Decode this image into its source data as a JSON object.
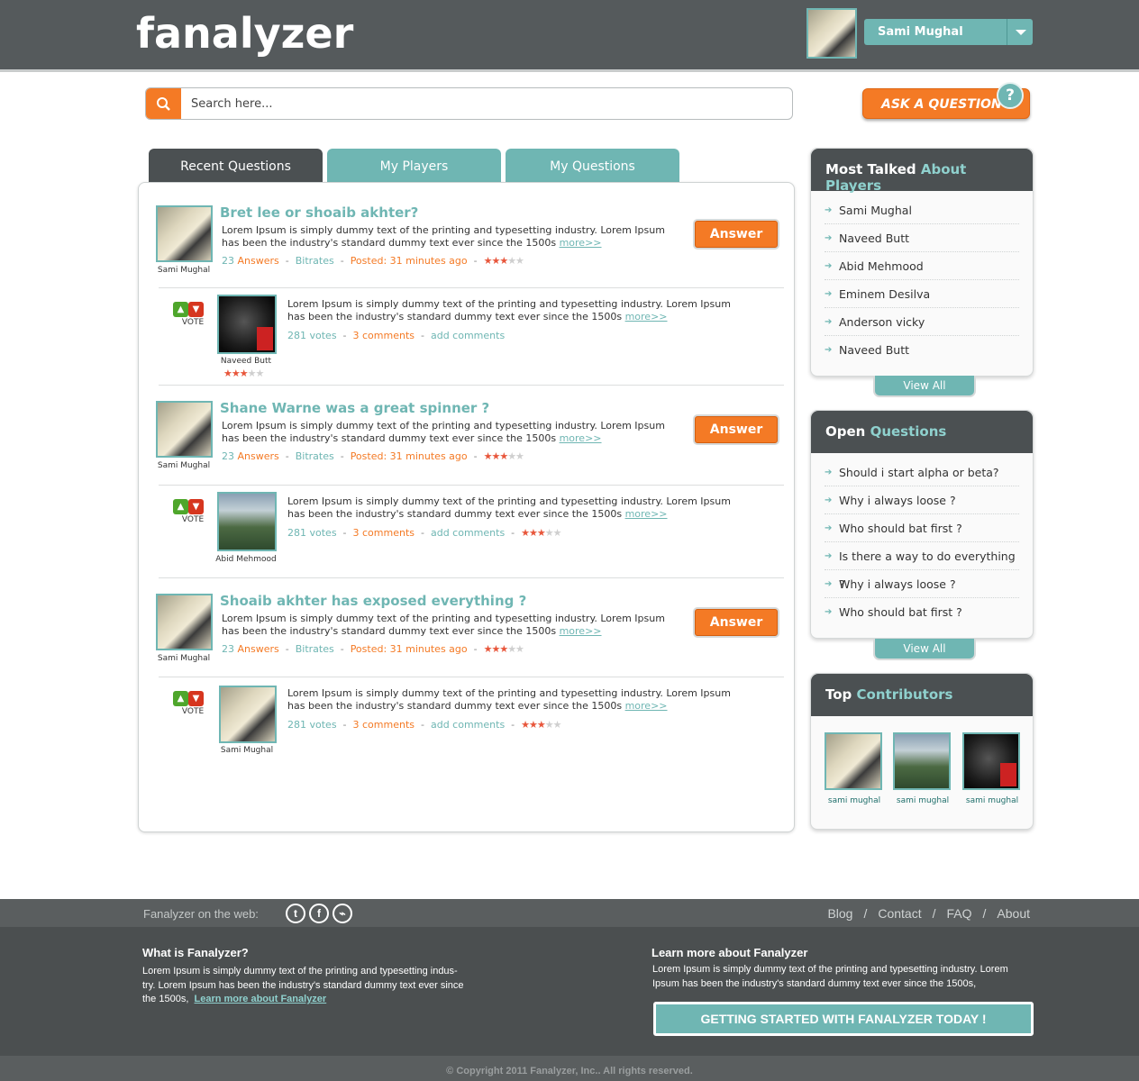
{
  "header": {
    "logo": "fanalyzer",
    "user_name": "Sami Mughal"
  },
  "search": {
    "placeholder": "Search here..."
  },
  "ask_button": "ASK A QUESTION",
  "tabs": [
    {
      "label": "Recent Questions",
      "active": true
    },
    {
      "label": "My Players",
      "active": false
    },
    {
      "label": "My Questions",
      "active": false
    }
  ],
  "questions": [
    {
      "user": "Sami Mughal",
      "title": "Bret lee or shoaib akhter?",
      "text": "Lorem Ipsum is simply dummy text of the printing and typesetting industry. Lorem Ipsum has been the industry's standard dummy text ever since the 1500s",
      "more": "more>>",
      "answers_count": "23",
      "answers_label": "Answers",
      "bitrates": "Bitrates",
      "posted": "Posted: 31 minutes ago",
      "rating": 3,
      "answer_button": "Answer",
      "reply": {
        "user": "Naveed Butt",
        "vote_label": "VOTE",
        "text": "Lorem Ipsum is simply dummy text of the printing and typesetting industry. Lorem Ipsum has been the industry's standard dummy text ever since the 1500s",
        "more": "more>>",
        "votes": "281 votes",
        "comments": "3 comments",
        "add_comments": "add comments",
        "rating": 3
      }
    },
    {
      "user": "Sami Mughal",
      "title": "Shane Warne was a great spinner ?",
      "text": "Lorem Ipsum is simply dummy text of the printing and typesetting industry. Lorem Ipsum has been the industry's standard dummy text ever since the 1500s",
      "more": "more>>",
      "answers_count": "23",
      "answers_label": "Answers",
      "bitrates": "Bitrates",
      "posted": "Posted: 31 minutes ago",
      "rating": 3,
      "answer_button": "Answer",
      "reply": {
        "user": "Abid Mehmood",
        "vote_label": "VOTE",
        "text": "Lorem Ipsum is simply dummy text of the printing and typesetting industry. Lorem Ipsum has been the industry's standard dummy text ever since the 1500s",
        "more": "more>>",
        "votes": "281 votes",
        "comments": "3 comments",
        "add_comments": "add comments",
        "rating": 3
      }
    },
    {
      "user": "Sami Mughal",
      "title": "Shoaib akhter has exposed everything ?",
      "text": "Lorem Ipsum is simply dummy text of the printing and typesetting industry. Lorem Ipsum has been the industry's standard dummy text ever since the 1500s",
      "more": "more>>",
      "answers_count": "23",
      "answers_label": "Answers",
      "bitrates": "Bitrates",
      "posted": "Posted: 31 minutes ago",
      "rating": 3,
      "answer_button": "Answer",
      "reply": {
        "user": "Sami Mughal",
        "vote_label": "VOTE",
        "text": "Lorem Ipsum is simply dummy text of the printing and typesetting industry. Lorem Ipsum has been the industry's standard dummy text ever since the 1500s",
        "more": "more>>",
        "votes": "281 votes",
        "comments": "3 comments",
        "add_comments": "add comments",
        "rating": 3
      }
    }
  ],
  "sidebar": {
    "players": {
      "title_plain": "Most Talked",
      "title_accent": "About Players",
      "items": [
        "Sami Mughal",
        "Naveed Butt",
        "Abid Mehmood",
        "Eminem Desilva",
        "Anderson vicky",
        "Naveed Butt"
      ],
      "view_all": "View All"
    },
    "open_questions": {
      "title_plain": "Open",
      "title_accent": "Questions",
      "items": [
        "Should i start alpha or beta?",
        "Why i always loose ?",
        "Who should bat first ?",
        "Is there a way to do everything ?",
        "Why i always loose ?",
        "Who should bat first ?"
      ],
      "view_all": "View All"
    },
    "contributors": {
      "title_plain": "Top",
      "title_accent": "Contributors",
      "items": [
        "sami mughal",
        "sami mughal",
        "sami mughal"
      ]
    }
  },
  "footer": {
    "on_web": "Fanalyzer on the web:",
    "nav": [
      "Blog",
      "Contact",
      "FAQ",
      "About"
    ],
    "what_title": "What is Fanalyzer?",
    "what_text_1": "Lorem Ipsum is simply dummy text of the printing and typesetting indus-",
    "what_text_2": "try. Lorem Ipsum has been the industry's standard dummy text ever since",
    "what_text_3": "the 1500s,",
    "what_link": "Learn more about Fanalyzer",
    "learn_title": "Learn more about Fanalyzer",
    "learn_text": "Lorem Ipsum is simply dummy text of the printing and typesetting industry. Lorem Ipsum has been the industry's standard dummy text ever since the 1500s,",
    "cta": "GETTING STARTED WITH FANALYZER TODAY !",
    "copyright": "© Copyright 2011 Fanalyzer, Inc.. All rights reserved."
  },
  "colors": {
    "teal": "#6fb6b3",
    "orange": "#f47a25",
    "dark": "#4b5052"
  }
}
